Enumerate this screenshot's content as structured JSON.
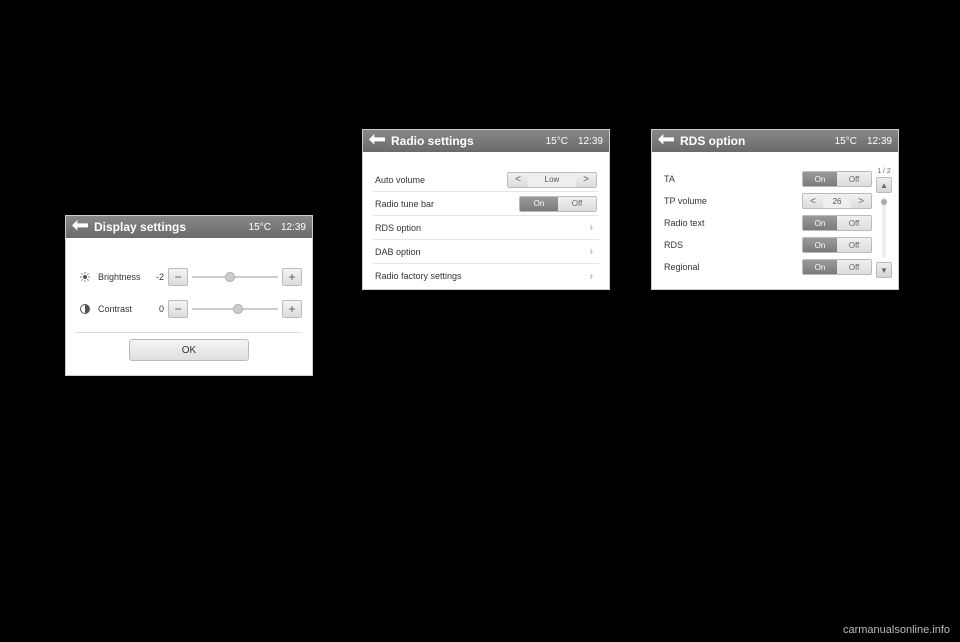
{
  "header_temp": "15°C",
  "header_time": "12:39",
  "display": {
    "title": "Display settings",
    "brightness_label": "Brightness",
    "brightness_value": "-2",
    "contrast_label": "Contrast",
    "contrast_value": "0",
    "ok_label": "OK"
  },
  "radio": {
    "title": "Radio settings",
    "rows": [
      {
        "label": "Auto volume",
        "value": "Low"
      },
      {
        "label": "Radio tune bar",
        "on": "On",
        "off": "Off"
      },
      {
        "label": "RDS option"
      },
      {
        "label": "DAB option"
      },
      {
        "label": "Radio factory settings"
      }
    ]
  },
  "rds": {
    "title": "RDS option",
    "page": "1 / 2",
    "rows": [
      {
        "label": "TA",
        "on": "On",
        "off": "Off"
      },
      {
        "label": "TP volume",
        "value": "26"
      },
      {
        "label": "Radio text",
        "on": "On",
        "off": "Off"
      },
      {
        "label": "RDS",
        "on": "On",
        "off": "Off"
      },
      {
        "label": "Regional",
        "on": "On",
        "off": "Off"
      }
    ]
  },
  "watermark": "carmanualsonline.info"
}
